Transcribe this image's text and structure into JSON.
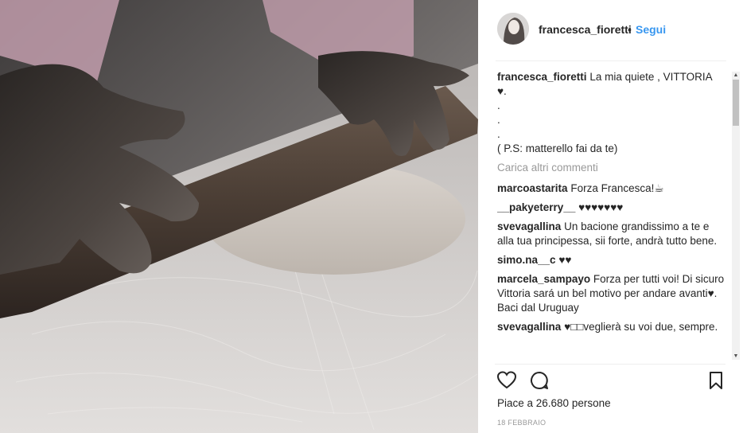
{
  "post": {
    "author": "francesca_fioretti",
    "follow_separator": "•",
    "follow_label": "Segui",
    "caption": {
      "user": "francesca_fioretti",
      "lines": [
        "La mia quiete , VITTORIA",
        "♥.",
        ".",
        ".",
        ".",
        "( P.S: matterello fai da te)"
      ]
    },
    "load_more_label": "Carica altri commenti",
    "comments": [
      {
        "user": "marcoastarita",
        "text": "Forza Francesca!☕"
      },
      {
        "user": "__pakyeterry__",
        "text": "♥♥♥♥♥♥♥"
      },
      {
        "user": "svevagallina",
        "text": "Un bacione grandissimo a te e alla tua principessa, sii forte, andrà tutto bene."
      },
      {
        "user": "simo.na__c",
        "text": "♥♥"
      },
      {
        "user": "marcela_sampayo",
        "text": "Forza per tutti voi! Di sicuro Vittoria sará un bel motivo per andare avanti♥. Baci dal Uruguay"
      },
      {
        "user": "svevagallina",
        "text": "♥□□veglierà su voi due, sempre."
      }
    ],
    "likes_text": "Piace a 26.680 persone",
    "date": "18 FEBBRAIO"
  },
  "icons": {
    "like": "heart-icon",
    "comment": "comment-icon",
    "save": "bookmark-icon"
  },
  "colors": {
    "link": "#3897f0",
    "text": "#262626",
    "muted": "#999999"
  }
}
